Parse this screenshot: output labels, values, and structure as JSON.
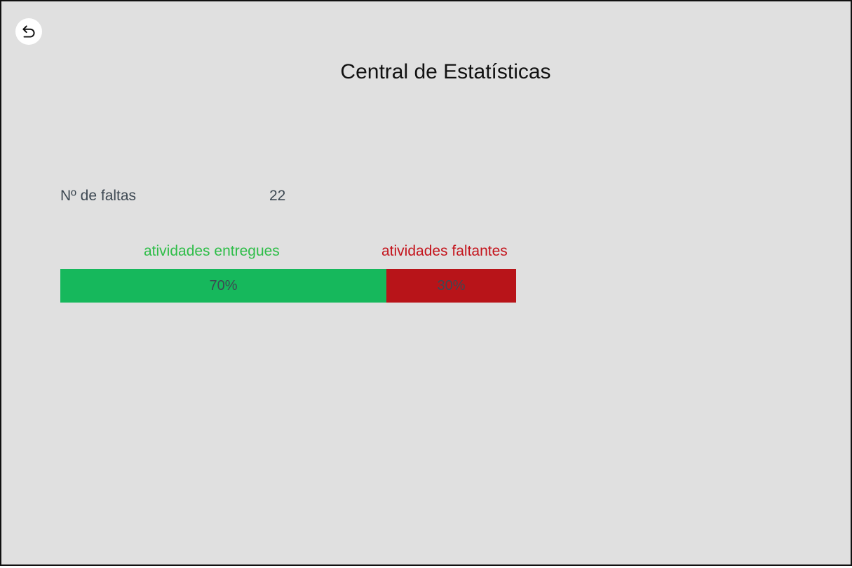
{
  "header": {
    "title": "Central de Estatísticas",
    "back_icon": "back-arrow-icon"
  },
  "stats": {
    "absences_label": "Nº de faltas",
    "absences_value": "22"
  },
  "activities": {
    "delivered_label": "atividades entregues",
    "missing_label": "atividades faltantes",
    "delivered_percent_text": "70%",
    "missing_percent_text": "30%",
    "delivered_fraction": 0.7,
    "missing_fraction": 0.3,
    "delivered_color": "#16b85c",
    "missing_color": "#b81419",
    "delivered_label_color": "#2ebd48",
    "missing_label_color": "#c4141c"
  }
}
